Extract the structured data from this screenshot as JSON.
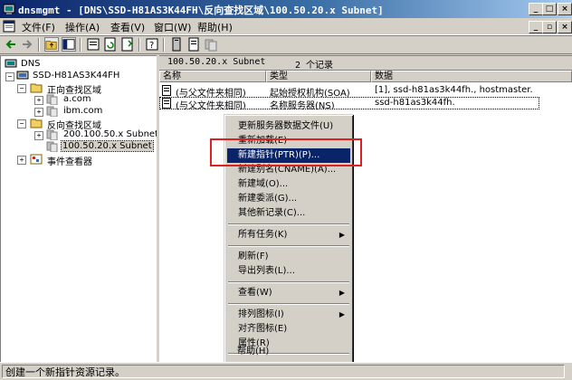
{
  "window": {
    "title": "dnsmgmt - [DNS\\SSD-H81AS3K44FH\\反向查找区域\\100.50.20.x Subnet]",
    "controls": {
      "minimize": "_",
      "maximize": "□",
      "close": "×"
    },
    "doc_controls": {
      "minimize": "_",
      "restore": "▫",
      "close": "×"
    }
  },
  "menubar": {
    "items": [
      "文件(F)",
      "操作(A)",
      "查看(V)",
      "窗口(W)",
      "帮助(H)"
    ]
  },
  "tree": {
    "root": "DNS",
    "server": "SSD-H81AS3K44FH",
    "forward_zone": "正向查找区域",
    "forward_children": [
      "a.com",
      "ibm.com"
    ],
    "reverse_zone": "反向查找区域",
    "reverse_children": [
      "200.100.50.x Subnet",
      "100.50.20.x Subnet"
    ],
    "event_viewer": "事件查看器"
  },
  "list": {
    "pane_title": "100.50.20.x Subnet",
    "record_count": "2 个记录",
    "columns": [
      "名称",
      "类型",
      "数据"
    ],
    "rows": [
      {
        "name": "(与父文件夹相同)",
        "type": "起始授权机构(SOA)",
        "data": "[1], ssd-h81as3k44fh., hostmaster."
      },
      {
        "name": "(与父文件夹相同)",
        "type": "名称服务器(NS)",
        "data": "ssd-h81as3k44fh."
      }
    ]
  },
  "context_menu": {
    "items": [
      {
        "label": "更新服务器数据文件(U)"
      },
      {
        "label": "重新加载(E)"
      },
      {
        "label": "新建指针(PTR)(P)...",
        "highlighted": true
      },
      {
        "label": "新建别名(CNAME)(A)..."
      },
      {
        "label": "新建域(O)..."
      },
      {
        "label": "新建委派(G)..."
      },
      {
        "label": "其他新记录(C)..."
      },
      {
        "label": "所有任务(K)",
        "submenu": true
      },
      {
        "label": "刷新(F)"
      },
      {
        "label": "导出列表(L)..."
      },
      {
        "label": "查看(W)",
        "submenu": true
      },
      {
        "label": "排列图标(I)",
        "submenu": true
      },
      {
        "label": "对齐图标(E)"
      },
      {
        "label": "属性(R)"
      },
      {
        "label": "帮助(H)"
      }
    ],
    "submenu_arrow": "▶"
  },
  "status": {
    "text": "创建一个新指针资源记录。"
  },
  "watermark": {
    "text": "Baidu 经验",
    "sub": "jingyan.baidu.com"
  },
  "colors": {
    "title_start": "#0a246a",
    "title_end": "#a6caf0",
    "highlight": "#0a246a",
    "annotation": "#e02020",
    "face": "#d4d0c8"
  }
}
